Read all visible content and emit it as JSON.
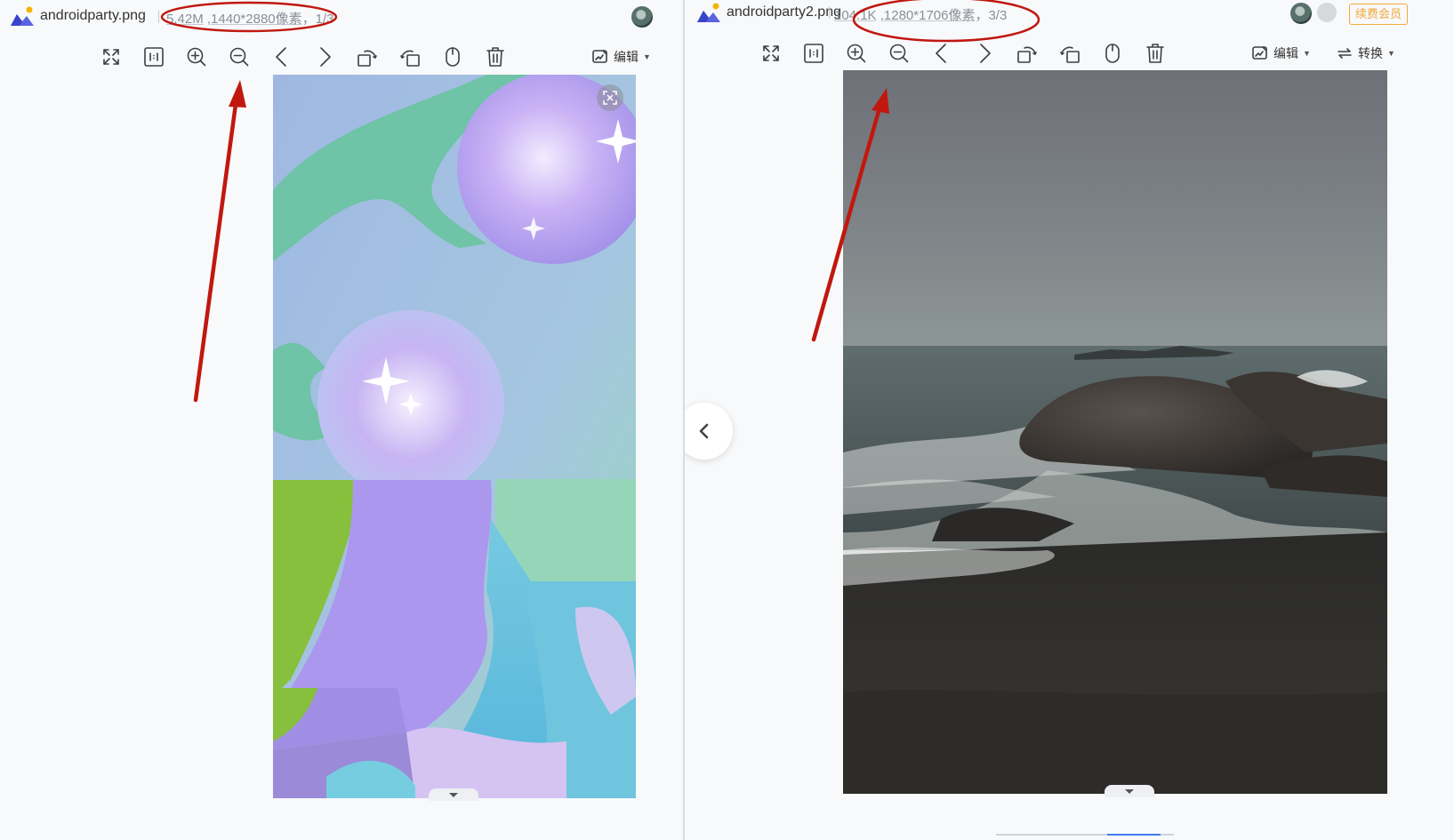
{
  "left": {
    "filename": "androidparty.png",
    "size": "5.42M",
    "dimensions": "1440*2880像素",
    "index_suffix": "，1/3",
    "edit_label": "编辑"
  },
  "right": {
    "filename": "androidparty2.png",
    "size": "104.1K",
    "dimensions": "1280*1706像素",
    "index_suffix": "，3/3",
    "edit_label": "编辑",
    "convert_label": "转换",
    "renew_label": "续费会员"
  },
  "toolbar_icons": [
    "fullscreen-icon",
    "actual-size-icon",
    "zoom-in-icon",
    "zoom-out-icon",
    "previous-icon",
    "next-icon",
    "rotate-left-icon",
    "rotate-right-icon",
    "mouse-icon",
    "delete-icon"
  ],
  "colors": {
    "annotation_red": "#c0180f",
    "accent_orange": "#f0a93a"
  }
}
